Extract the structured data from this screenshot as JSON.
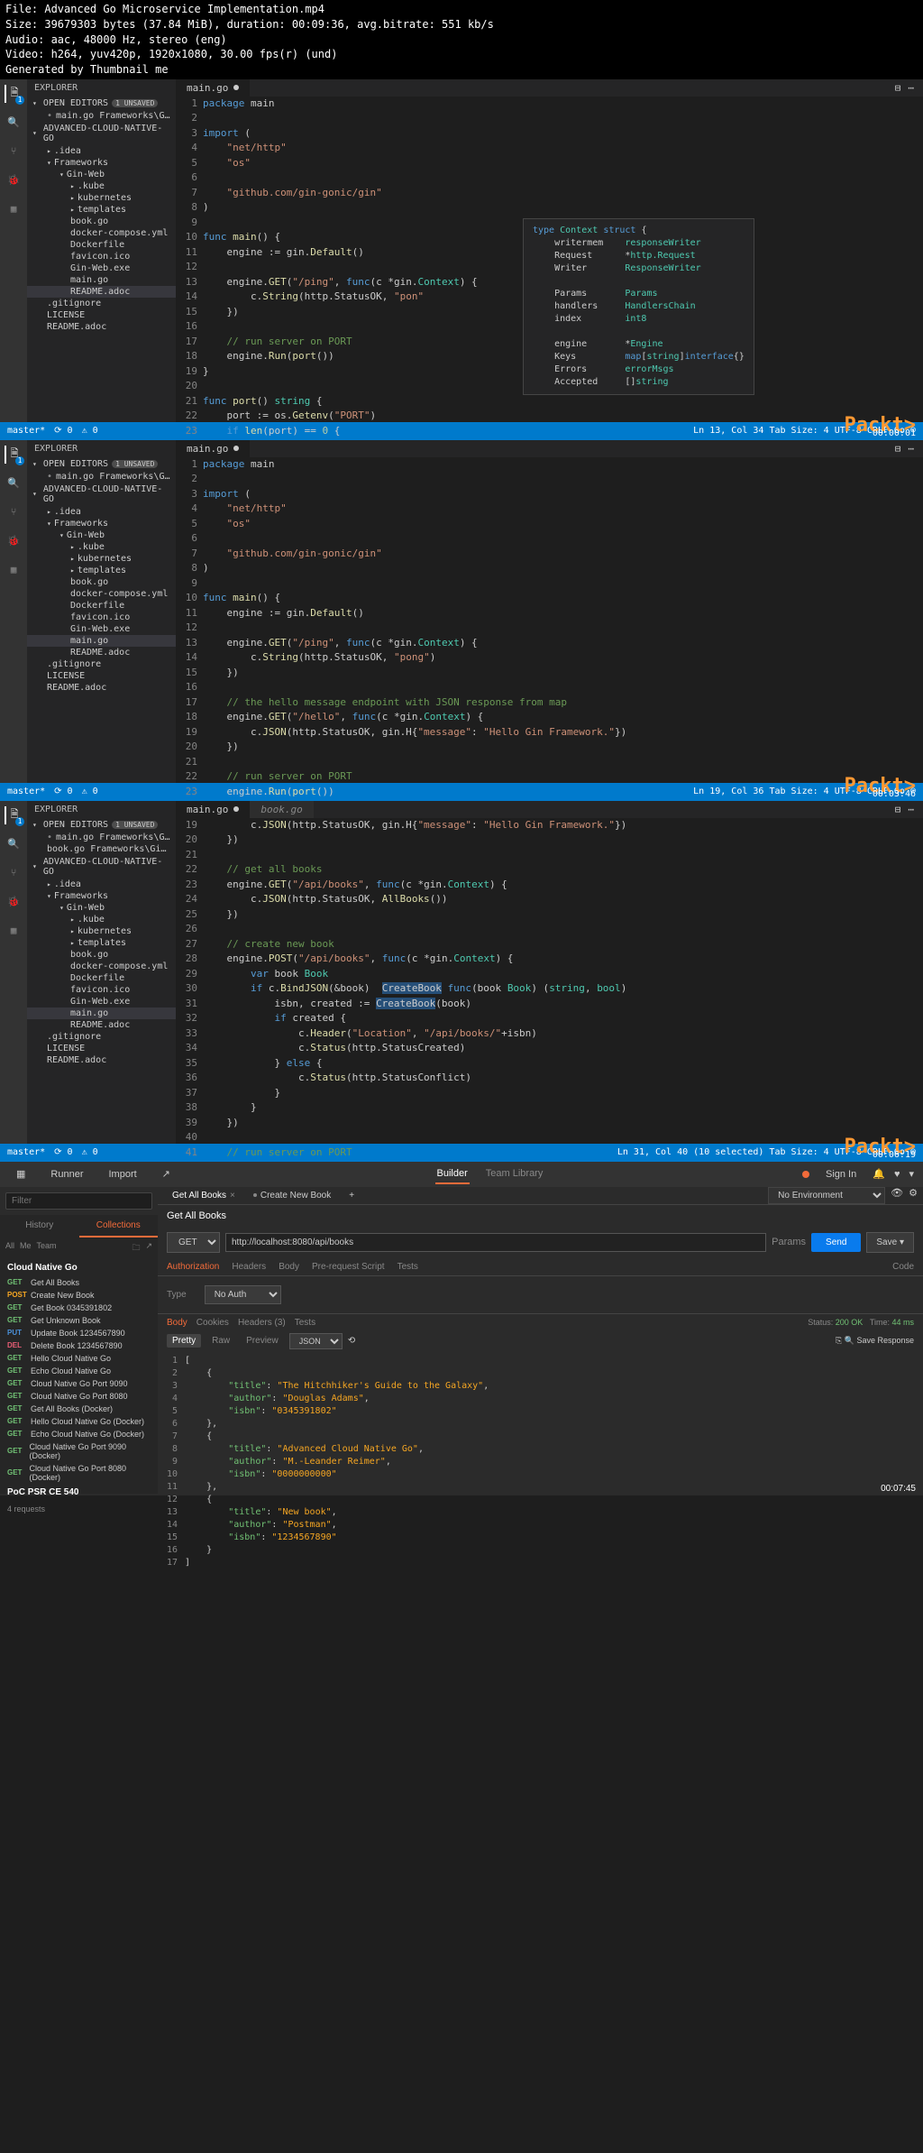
{
  "meta": {
    "file": "File: Advanced Go Microservice Implementation.mp4",
    "size": "Size: 39679303 bytes (37.84 MiB), duration: 00:09:36, avg.bitrate: 551 kb/s",
    "audio": "Audio: aac, 48000 Hz, stereo (eng)",
    "video": "Video: h264, yuv420p, 1920x1080, 30.00 fps(r) (und)",
    "gen": "Generated by Thumbnail me"
  },
  "packt": "Packt>",
  "frame1": {
    "explorer": "EXPLORER",
    "openEditors": "OPEN EDITORS",
    "unsaved": "1 UNSAVED",
    "editorItem": "main.go",
    "editorSub": "Frameworks\\Gin-Web",
    "project": "ADVANCED-CLOUD-NATIVE-GO",
    "tree": {
      "idea": ".idea",
      "frameworks": "Frameworks",
      "ginweb": "Gin-Web",
      "kube": ".kube",
      "kubernetes": "kubernetes",
      "templates": "templates",
      "bookgo": "book.go",
      "compose": "docker-compose.yml",
      "dockerfile": "Dockerfile",
      "favicon": "favicon.ico",
      "ginexe": "Gin-Web.exe",
      "maingo": "main.go",
      "readme": "README.adoc",
      "gitignore": ".gitignore",
      "license": "LICENSE",
      "readme2": "README.adoc"
    },
    "tab": "main.go",
    "tooltip": "type Context struct {\n    writermem    responseWriter\n    Request      *http.Request\n    Writer       ResponseWriter\n\n    Params       Params\n    handlers     HandlersChain\n    index        int8\n\n    engine       *Engine\n    Keys         map[string]interface{}\n    Errors       errorMsgs\n    Accepted     []string",
    "status": {
      "branch": "master*",
      "sync": "⟳ 0",
      "warn": "⚠ 0",
      "right": "Ln 13, Col 34   Tab Size: 4   UTF-8   CRLF   Go   ☺"
    },
    "ts": "00:00:01"
  },
  "frame2": {
    "status": {
      "right": "Ln 19, Col 36   Tab Size: 4   UTF-8   CRLF   Go   ☺"
    },
    "ts": "00:03:46"
  },
  "frame3": {
    "editorItem2": "book.go",
    "tab2": "book.go",
    "tooltip": "CreateBook func(book Book) (string, bool)",
    "status": {
      "right": "Ln 31, Col 40 (10 selected)   Tab Size: 4   UTF-8   CRLF   Go   ☺"
    },
    "ts": "00:06:19"
  },
  "postman": {
    "header": {
      "runner": "Runner",
      "import": "Import",
      "builder": "Builder",
      "team": "Team Library",
      "signin": "Sign In"
    },
    "search": "Filter",
    "sideTabs": {
      "history": "History",
      "collections": "Collections"
    },
    "subtabs": {
      "all": "All",
      "me": "Me",
      "team": "Team"
    },
    "collection": "Cloud Native Go",
    "requests": [
      {
        "m": "GET",
        "name": "Get All Books"
      },
      {
        "m": "POST",
        "name": "Create New Book"
      },
      {
        "m": "GET",
        "name": "Get Book 0345391802"
      },
      {
        "m": "GET",
        "name": "Get Unknown Book"
      },
      {
        "m": "PUT",
        "name": "Update Book 1234567890"
      },
      {
        "m": "DEL",
        "name": "Delete Book 1234567890"
      },
      {
        "m": "GET",
        "name": "Hello Cloud Native Go"
      },
      {
        "m": "GET",
        "name": "Echo Cloud Native Go"
      },
      {
        "m": "GET",
        "name": "Cloud Native Go Port 9090"
      },
      {
        "m": "GET",
        "name": "Cloud Native Go Port 8080"
      },
      {
        "m": "GET",
        "name": "Get All Books (Docker)"
      },
      {
        "m": "GET",
        "name": "Hello Cloud Native Go (Docker)"
      },
      {
        "m": "GET",
        "name": "Echo Cloud Native Go (Docker)"
      },
      {
        "m": "GET",
        "name": "Cloud Native Go Port 9090 (Docker)"
      },
      {
        "m": "GET",
        "name": "Cloud Native Go Port 8080 (Docker)"
      }
    ],
    "coll2": "PoC PSR CE 540",
    "coll2sub": "4 requests",
    "tabs": {
      "t1": "Get All Books",
      "t2": "Create New Book"
    },
    "env": "No Environment",
    "reqName": "Get All Books",
    "method": "GET",
    "url": "http://localhost:8080/api/books",
    "params": "Params",
    "send": "Send",
    "save": "Save",
    "reqTabs": {
      "auth": "Authorization",
      "headers": "Headers",
      "body": "Body",
      "prereq": "Pre-request Script",
      "tests": "Tests"
    },
    "authType": "Type",
    "authVal": "No Auth",
    "code": "Code",
    "respTabs": {
      "body": "Body",
      "cookies": "Cookies",
      "headers": "Headers (3)",
      "tests": "Tests"
    },
    "respStatus": "Status: 200 OK   Time: 44 ms",
    "fmt": {
      "pretty": "Pretty",
      "raw": "Raw",
      "preview": "Preview",
      "json": "JSON"
    },
    "saveResp": "Save Response",
    "json": "[\n    {\n        \"title\": \"The Hitchhiker's Guide to the Galaxy\",\n        \"author\": \"Douglas Adams\",\n        \"isbn\": \"0345391802\"\n    },\n    {\n        \"title\": \"Advanced Cloud Native Go\",\n        \"author\": \"M.-Leander Reimer\",\n        \"isbn\": \"0000000000\"\n    },\n    {\n        \"title\": \"New book\",\n        \"author\": \"Postman\",\n        \"isbn\": \"1234567890\"\n    }\n]",
    "ts": "00:07:45"
  }
}
